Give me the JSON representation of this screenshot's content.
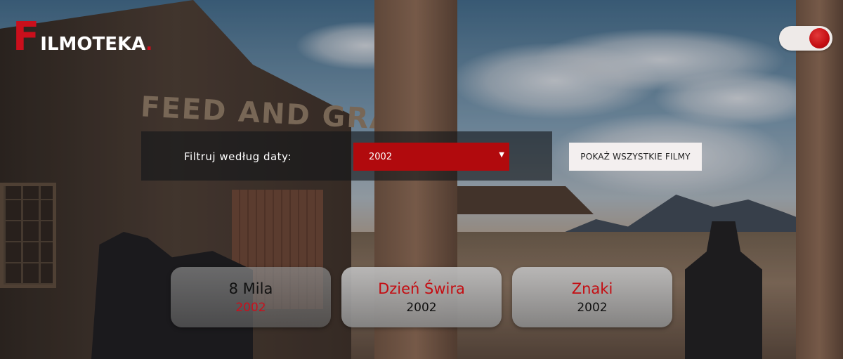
{
  "header": {
    "logo_initial": "F",
    "logo_rest": "ILMOTEKA",
    "logo_dot": "."
  },
  "theme_toggle": {
    "state": "on"
  },
  "filter": {
    "label": "Filtruj według daty:",
    "selected_year": "2002",
    "show_all_label": "POKAŻ WSZYSTKIE FILMY"
  },
  "films": [
    {
      "title": "8 Mila",
      "year": "2002"
    },
    {
      "title": "Dzień Świra",
      "year": "2002"
    },
    {
      "title": "Znaki",
      "year": "2002"
    }
  ],
  "colors": {
    "accent": "#ca0f1c",
    "select_bg": "#b10a0d",
    "button_bg": "#f3efef"
  },
  "background": {
    "sign_text": "FEED AND GRAIN"
  }
}
